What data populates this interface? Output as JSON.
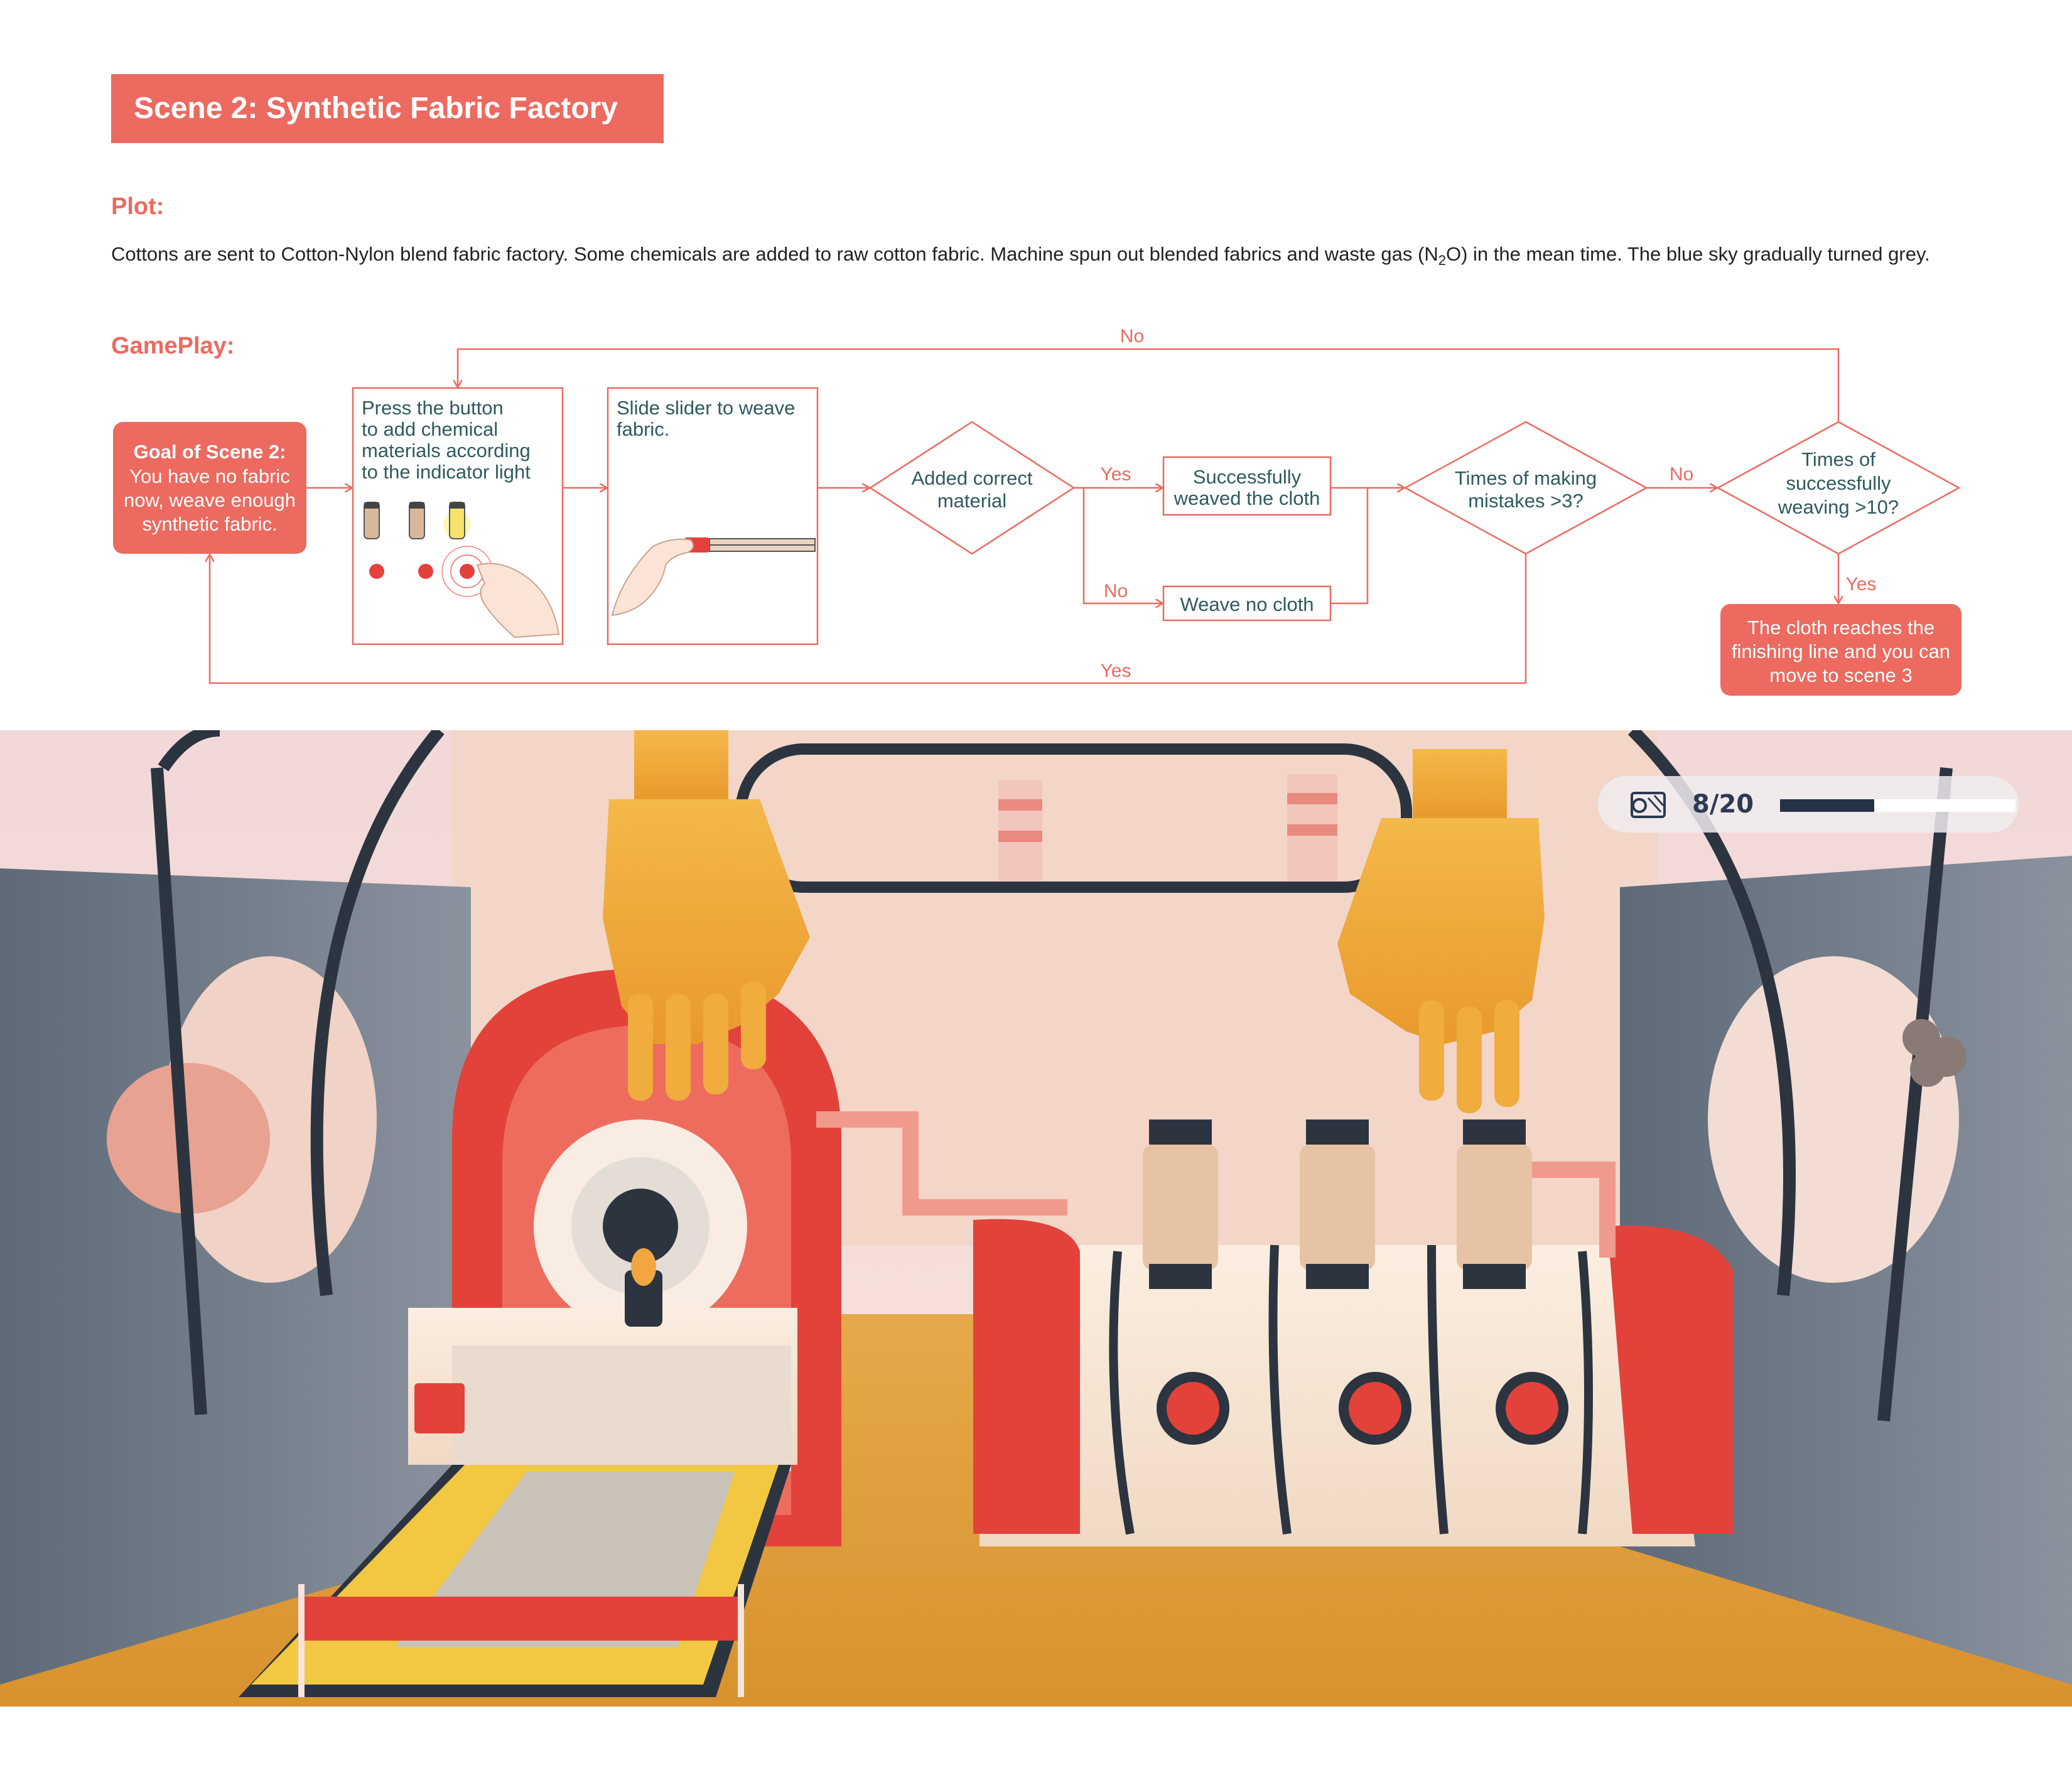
{
  "header": {
    "title": "Scene 2: Synthetic Fabric Factory"
  },
  "plot": {
    "heading": "Plot:",
    "text_before": "Cottons are sent to Cotton-Nylon blend fabric factory. Some chemicals are added to raw cotton fabric. Machine spun out blended fabrics and waste gas (N",
    "subscript": "2",
    "text_after": "O) in the mean time. The blue sky gradually turned grey."
  },
  "gameplay": {
    "heading": "GamePlay:",
    "goal": {
      "title": "Goal of Scene 2:",
      "lines": [
        "You have no fabric",
        "now, weave enough",
        "synthetic fabric."
      ]
    },
    "step1": [
      "Press the button",
      "to add chemical",
      "materials according",
      "to the indicator light"
    ],
    "step2": [
      "Slide slider to weave",
      "fabric."
    ],
    "decision1": [
      "Added correct",
      "material"
    ],
    "success": [
      "Successfully",
      "weaved the cloth"
    ],
    "no_cloth": "Weave no cloth",
    "decision2": [
      "Times of making",
      "mistakes >3?"
    ],
    "decision3": [
      "Times of",
      "successfully",
      "weaving >10?"
    ],
    "finish": [
      "The cloth reaches the",
      "finishing line and you can",
      "move to scene 3"
    ],
    "labels": {
      "yes": "Yes",
      "no": "No"
    }
  },
  "game_hud": {
    "counter": "8/20",
    "progress": 0.4,
    "icon": "fabric-roll-icon"
  },
  "colors": {
    "accent": "#ec6a5f",
    "text_teal": "#2f5a5e",
    "hud_dark": "#243247",
    "floor": "#e0a040",
    "machine_red": "#e2423a"
  }
}
